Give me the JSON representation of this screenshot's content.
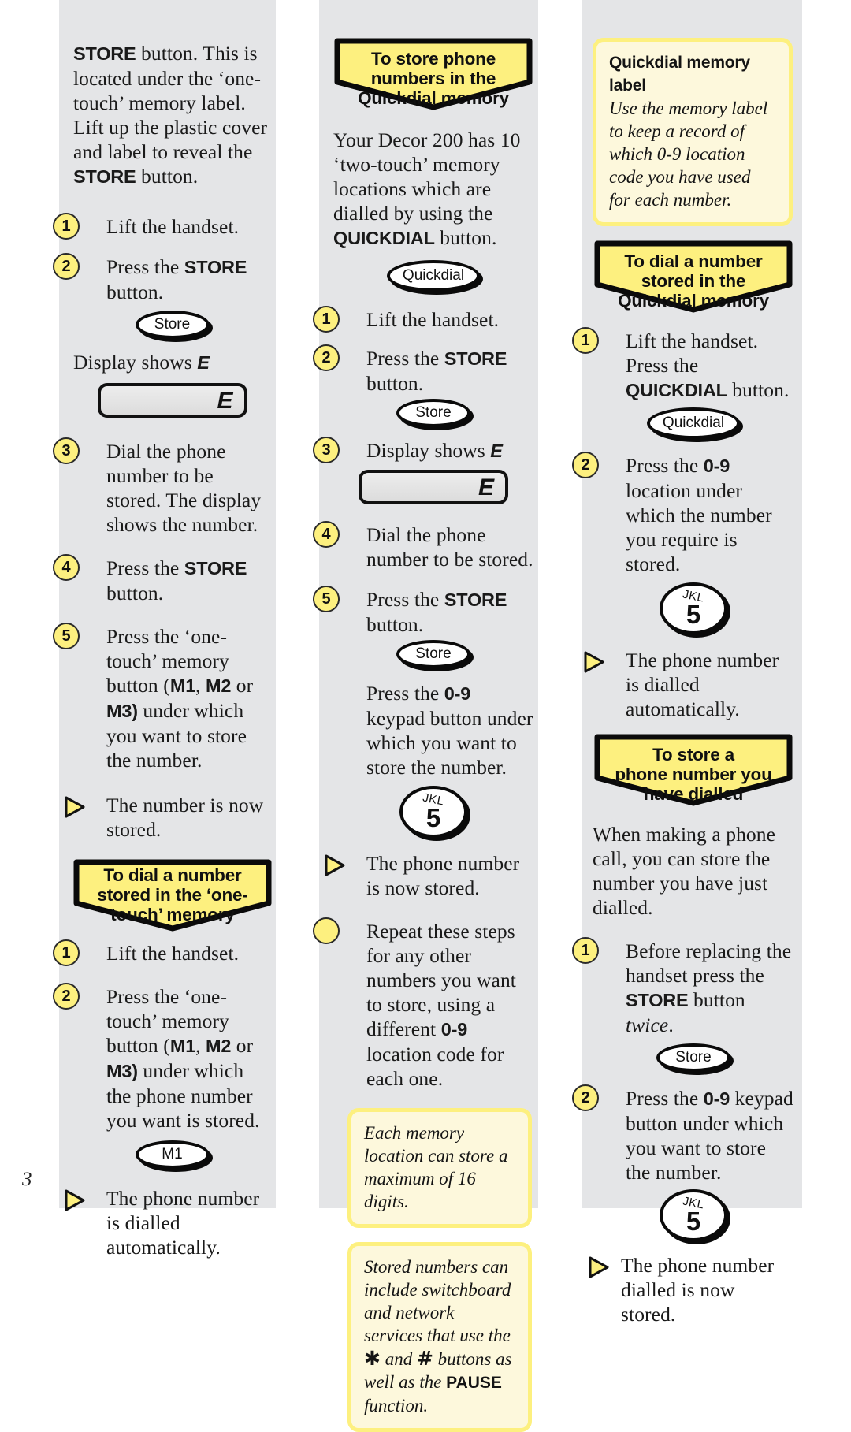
{
  "page": {
    "number": "3"
  },
  "colors": {
    "column_bg": "#e4e5e7",
    "banner_yellow": "#fdf07f",
    "note_fill": "#fdf8dc",
    "note_border": "#fdf07f",
    "ink": "#1a1a1a"
  },
  "column1": {
    "intro": {
      "bold1": "STORE",
      "text1": " button. This is located under the ‘one-touch’ memory label. Lift up the plastic cover and label to reveal the ",
      "bold2": "STORE",
      "text2": " button."
    },
    "steps": [
      {
        "num": "1",
        "text": "Lift the handset."
      },
      {
        "num": "2",
        "pre": "Press the ",
        "bold": "STORE",
        "post": " button."
      },
      {
        "num": "3",
        "text": "Dial the phone number to be stored. The display shows the number."
      },
      {
        "num": "4",
        "pre": "Press the ",
        "bold": "STORE",
        "post": " button."
      }
    ],
    "store_key_label": "Store",
    "display_caption_pre": "Display shows ",
    "display_caption_em": "E",
    "lcd_value": "E",
    "step5": {
      "num": "5",
      "p1": "Press the ‘one-touch’ memory button (",
      "b1": "M1",
      "p2": ", ",
      "b2": "M2",
      "p3": " or ",
      "b3": "M3)",
      "p4": " under which you want to store the number."
    },
    "result": "The number is now stored.",
    "banner": [
      "To dial a number",
      "stored in the ‘one-",
      "touch’ memory"
    ],
    "dial_steps": [
      {
        "num": "1",
        "text": "Lift the handset."
      }
    ],
    "dial_step2": {
      "num": "2",
      "p1": "Press the ‘one-touch’ memory button (",
      "b1": "M1",
      "p2": ", ",
      "b2": "M2",
      "p3": " or ",
      "b3": "M3)",
      "p4": " under which the phone number you want is stored."
    },
    "m1_key_label": "M1",
    "dial_result": "The phone number is dialled automatically."
  },
  "column2": {
    "banner": [
      "To store phone",
      "numbers in the",
      "Quickdial memory"
    ],
    "intro": {
      "pre": "Your Decor 200 has 10 ‘two-touch’ memory locations which are dialled by using the ",
      "bold": "QUICKDIAL",
      "post": " button."
    },
    "quickdial_key_label": "Quickdial",
    "steps": [
      {
        "num": "1",
        "text": "Lift the handset."
      },
      {
        "num": "2",
        "pre": "Press the ",
        "bold": "STORE",
        "post": " button."
      },
      {
        "num": "3",
        "pre": "Display shows ",
        "em": "E"
      },
      {
        "num": "4",
        "text": "Dial the phone number to be stored."
      },
      {
        "num": "5",
        "pre": "Press the ",
        "bold": "STORE",
        "post": " button."
      }
    ],
    "store_key_label": "Store",
    "lcd_value": "E",
    "keypad_note": {
      "pre": "Press the ",
      "bold": "0-9",
      "post": " keypad button under which you want to store the number."
    },
    "key": {
      "letters": "JKL",
      "digit": "5"
    },
    "result": "The phone number is now stored.",
    "repeat": {
      "p1": "Repeat these steps for any other numbers you want to store, using a different ",
      "b1": "0-9",
      "p2": " location code for each one."
    },
    "note1": "Each memory location can store a maximum of 16 digits.",
    "note2": {
      "t1": "Stored numbers can include switchboard and network services that use the ",
      "star": "✱",
      "t2": " and ",
      "hash": "#",
      "t3": " buttons as well as the ",
      "bold": "PAUSE",
      "t4": " function."
    }
  },
  "column3": {
    "note_label": {
      "head": "Quickdial memory label",
      "body": "Use the memory label to keep a record of which 0-9 location code you have used for each number."
    },
    "banner1": [
      "To dial a number",
      "stored in the",
      "Quickdial memory"
    ],
    "step1": {
      "num": "1",
      "l1": "Lift the handset.",
      "pre": "Press the ",
      "bold": "QUICKDIAL",
      "post": " button."
    },
    "quickdial_key_label": "Quickdial",
    "step2": {
      "num": "2",
      "pre": "Press the ",
      "bold": "0-9",
      "post": " location under which the number you require is stored."
    },
    "key": {
      "letters": "JKL",
      "digit": "5"
    },
    "result1": "The phone number is dialled automatically.",
    "banner2": [
      "To store a",
      "phone number you",
      "have dialled"
    ],
    "intro2": "When making a phone call, you can store the number you have just dialled.",
    "store_step": {
      "num": "1",
      "pre": "Before replacing the handset press the ",
      "bold": "STORE",
      "mid": " button ",
      "em": "twice",
      "post": "."
    },
    "store_key_label": "Store",
    "keypad_step": {
      "num": "2",
      "pre": "Press the ",
      "bold": "0-9",
      "post": " keypad button under which you want to store the number."
    },
    "result2": "The phone number dialled is now stored."
  }
}
